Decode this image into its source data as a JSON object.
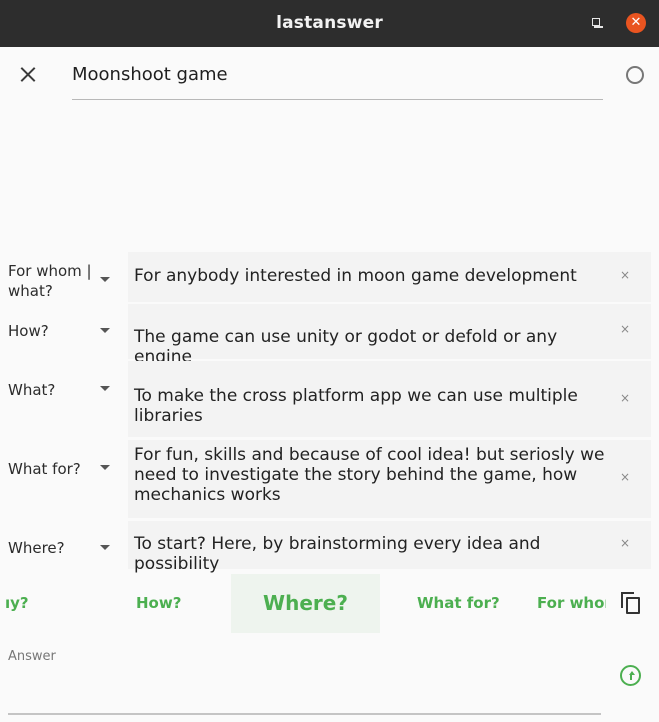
{
  "window": {
    "title": "lastanswer",
    "minimize_icon": "minimize-icon",
    "maximize_icon": "maximize-icon",
    "close_icon": "close-icon",
    "close_glyph": "✕",
    "close_color": "#e95420"
  },
  "header": {
    "close_icon": "close-icon",
    "title_value": "Moonshoot game",
    "status_icon": "circle-icon"
  },
  "rows": [
    {
      "question": "For whom | what?",
      "answer": "For anybody interested in moon game development",
      "remove": "×"
    },
    {
      "question": "How?",
      "answer": "The game can use unity or godot or defold or any engine",
      "remove": "×"
    },
    {
      "question": "What?",
      "answer": "To make the cross platform app we can use multiple libraries",
      "remove": "×"
    },
    {
      "question": "What for?",
      "answer": "For fun, skills and because of cool idea! but seriosly we need to investigate the story behind the game, how mechanics works",
      "remove": "×"
    },
    {
      "question": "Where?",
      "answer": "To start? Here, by brainstorming every idea and possibility",
      "remove": "×"
    }
  ],
  "tabs": {
    "items": [
      "ıy?",
      "How?",
      "Where?",
      "What for?",
      "For whom"
    ],
    "active": "Where?",
    "accent_color": "#4caf50",
    "copy_icon": "copy-icon"
  },
  "answer_field": {
    "label": "Answer",
    "value": "",
    "send_icon": "send-icon"
  }
}
